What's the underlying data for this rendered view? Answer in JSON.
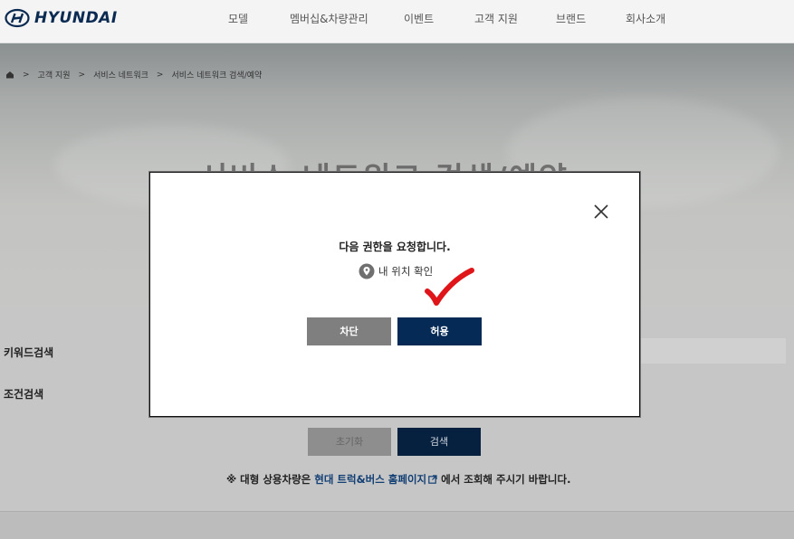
{
  "brand": {
    "name": "HYUNDAI",
    "color": "#0a2a52"
  },
  "nav": {
    "items": [
      "모델",
      "멤버십&차량관리",
      "이벤트",
      "고객 지원",
      "브랜드",
      "회사소개"
    ]
  },
  "breadcrumb": {
    "items": [
      "고객 지원",
      "서비스 네트워크",
      "서비스 네트워크 검색/예약"
    ]
  },
  "page": {
    "title": "서비스 네트워크 검색/예약"
  },
  "search": {
    "keyword_label": "키워드검색",
    "condition_label": "조건검색",
    "reset_label": "초기화",
    "search_label": "검색"
  },
  "notice": {
    "prefix": "※ 대형 상용차량은 ",
    "link": "현대 트럭&버스 홈페이지",
    "suffix": " 에서 조회해 주시기 바랍니다."
  },
  "modal": {
    "message": "다음 권한을 요청합니다.",
    "permission": "내 위치 확인",
    "block_label": "차단",
    "allow_label": "허용",
    "icons": {
      "close": "close-icon",
      "location": "location-pin-icon",
      "annotation": "red-checkmark-icon"
    },
    "colors": {
      "allow": "#052a56",
      "block": "#7f7f7f",
      "check": "#e0151a"
    }
  }
}
